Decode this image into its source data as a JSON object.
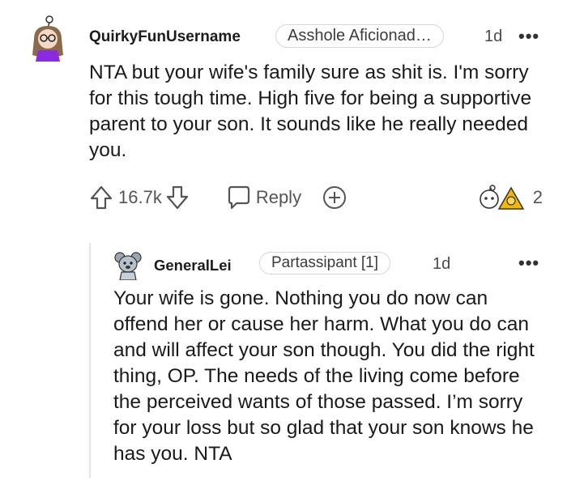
{
  "comment": {
    "username": "QuirkyFunUsername",
    "flair": "Asshole Aficionad…",
    "age": "1d",
    "more": "•••",
    "body": "NTA but your wife's family sure as shit is. I'm sorry for this tough time. High five for being a supportive parent to your son. It sounds like he really needed you.",
    "score": "16.7k",
    "reply_label": "Reply",
    "awards_count": "2"
  },
  "reply": {
    "username": "GeneralLei",
    "flair": "Partassipant [1]",
    "age": "1d",
    "more": "•••",
    "body": "Your wife is gone. Nothing you do now can offend her or cause her harm. What you do can and will affect your son though. You did the right thing, OP. The needs of the living come before the perceived wants of those passed. I’m sorry for your loss but so glad that your son knows he has you. NTA"
  },
  "colors": {
    "text": "#1a1a1b",
    "meta": "#4a4a4a",
    "border": "#d3d6da",
    "award_gold": "#f5b800"
  }
}
